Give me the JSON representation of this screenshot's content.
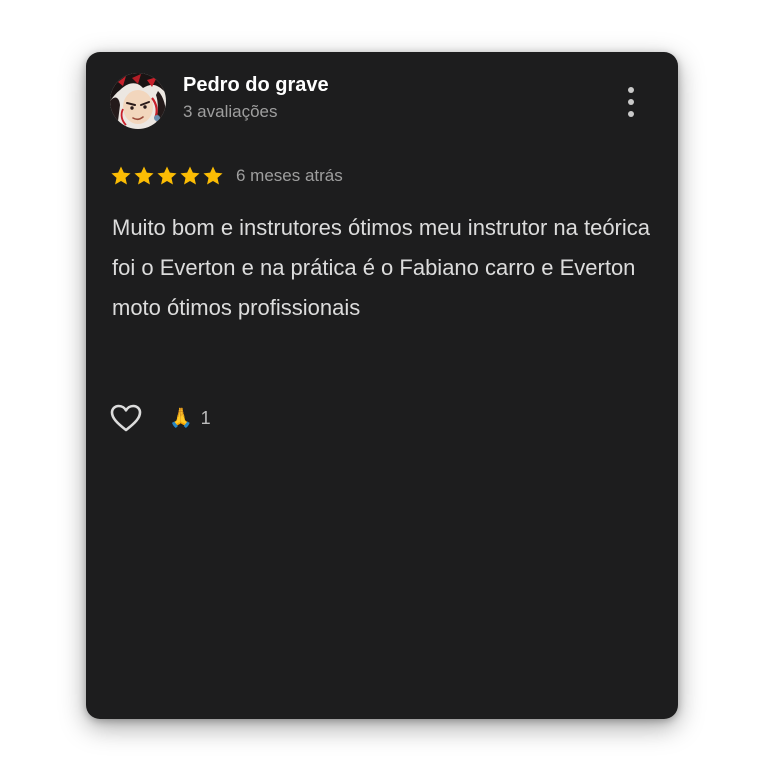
{
  "review": {
    "author": {
      "name": "Pedro do grave",
      "reviews_count": "3 avaliações",
      "avatar": "anime-character-avatar"
    },
    "rating": 5,
    "rating_max": 5,
    "date": "6 meses atrás",
    "text": "Muito bom e instrutores ótimos meu instrutor na teórica foi o Everton e na prática é o Fabiano carro e Everton moto ótimos profissionais",
    "actions": {
      "like_icon": "heart-outline-icon",
      "menu_icon": "more-vertical-icon",
      "reaction": {
        "emoji": "🙏",
        "count": "1"
      }
    }
  },
  "colors": {
    "card_background": "#1d1d1e",
    "star": "#fbbc04",
    "name": "#ffffff",
    "secondary_text": "#9e9e9e",
    "body_text": "#dcdcdc"
  }
}
